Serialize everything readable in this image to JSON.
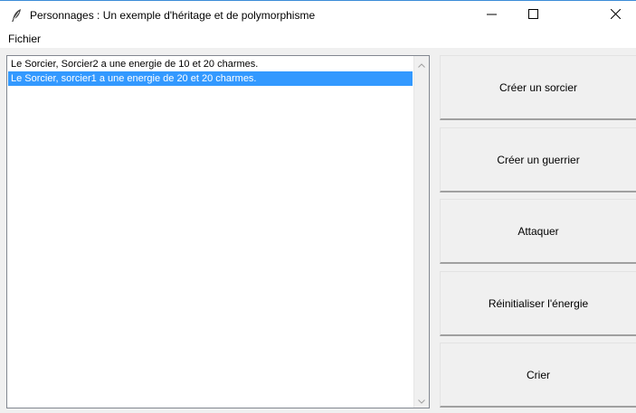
{
  "window": {
    "title": "Personnages : Un exemple d'héritage et de polymorphisme",
    "icon": "feather-icon"
  },
  "menu": {
    "items": [
      {
        "label": "Fichier"
      }
    ]
  },
  "listbox": {
    "items": [
      {
        "text": "Le Sorcier, Sorcier2 a une energie de 10 et 20 charmes.",
        "selected": false
      },
      {
        "text": "Le Sorcier, sorcier1 a une energie de 20 et 20 charmes.",
        "selected": true
      }
    ]
  },
  "buttons": [
    {
      "label": "Créer un sorcier"
    },
    {
      "label": "Créer un guerrier"
    },
    {
      "label": "Attaquer"
    },
    {
      "label": "Réinitialiser l'énergie"
    },
    {
      "label": "Crier"
    }
  ],
  "colors": {
    "selection": "#3399ff",
    "background": "#f0f0f0"
  }
}
